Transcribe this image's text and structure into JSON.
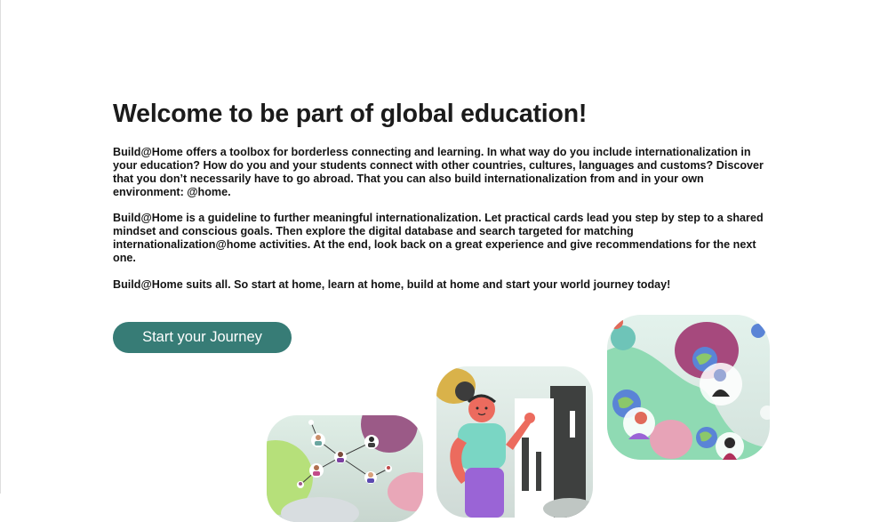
{
  "hero": {
    "title": "Welcome to be part of global education!",
    "paragraphs": [
      "Build@Home offers a toolbox for borderless connecting and learning. In what way do you include internationalization in your education? How do you and your students connect with other countries, cultures, languages and customs? Discover that you don’t necessarily have to go abroad. That you can also build internationalization from and in your own environment: @home.",
      "Build@Home is a guideline to further meaningful internationalization. Let practical cards  lead you step by step to a shared mindset and conscious goals. Then explore the digital database and search targeted for matching internationalization@home activities.  At the end, look back on a great experience and give recommendations for the next one.",
      "Build@Home suits all. So start at home, learn at home, build at home and start your world journey today!"
    ],
    "cta_label": "Start your Journey"
  },
  "colors": {
    "accent": "#377c76",
    "text": "#1b1b1b",
    "background": "#ffffff"
  },
  "illustrations": [
    {
      "subject": "network of connected people"
    },
    {
      "subject": "person waving in front of a city"
    },
    {
      "subject": "people with globes"
    }
  ]
}
